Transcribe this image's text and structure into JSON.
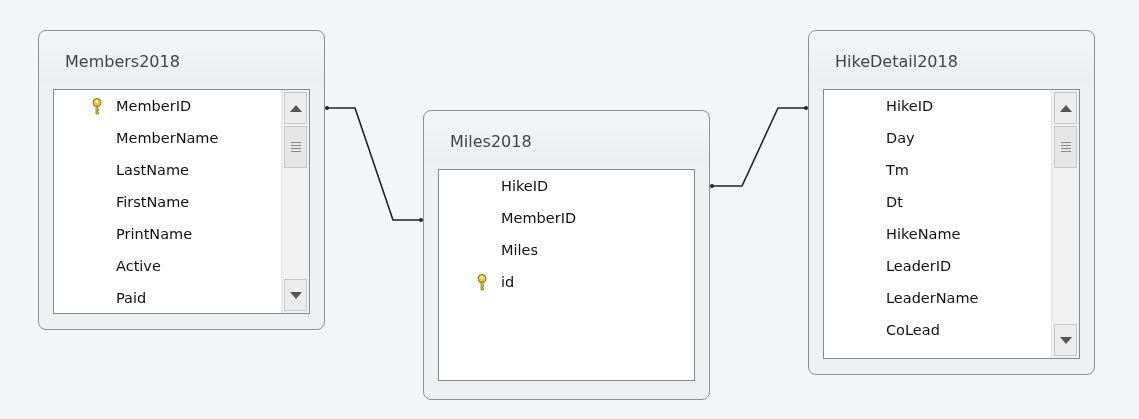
{
  "tables": [
    {
      "title": "Members2018",
      "scrollbar": true,
      "fields": [
        {
          "name": "MemberID",
          "primary_key": true
        },
        {
          "name": "MemberName",
          "primary_key": false
        },
        {
          "name": "LastName",
          "primary_key": false
        },
        {
          "name": "FirstName",
          "primary_key": false
        },
        {
          "name": "PrintName",
          "primary_key": false
        },
        {
          "name": "Active",
          "primary_key": false
        },
        {
          "name": "Paid",
          "primary_key": false
        }
      ]
    },
    {
      "title": "Miles2018",
      "scrollbar": false,
      "fields": [
        {
          "name": "HikeID",
          "primary_key": false
        },
        {
          "name": "MemberID",
          "primary_key": false
        },
        {
          "name": "Miles",
          "primary_key": false
        },
        {
          "name": "id",
          "primary_key": true
        }
      ]
    },
    {
      "title": "HikeDetail2018",
      "scrollbar": true,
      "fields": [
        {
          "name": "HikeID",
          "primary_key": false
        },
        {
          "name": "Day",
          "primary_key": false
        },
        {
          "name": "Tm",
          "primary_key": false
        },
        {
          "name": "Dt",
          "primary_key": false
        },
        {
          "name": "HikeName",
          "primary_key": false
        },
        {
          "name": "LeaderID",
          "primary_key": false
        },
        {
          "name": "LeaderName",
          "primary_key": false
        },
        {
          "name": "CoLead",
          "primary_key": false
        }
      ]
    }
  ]
}
